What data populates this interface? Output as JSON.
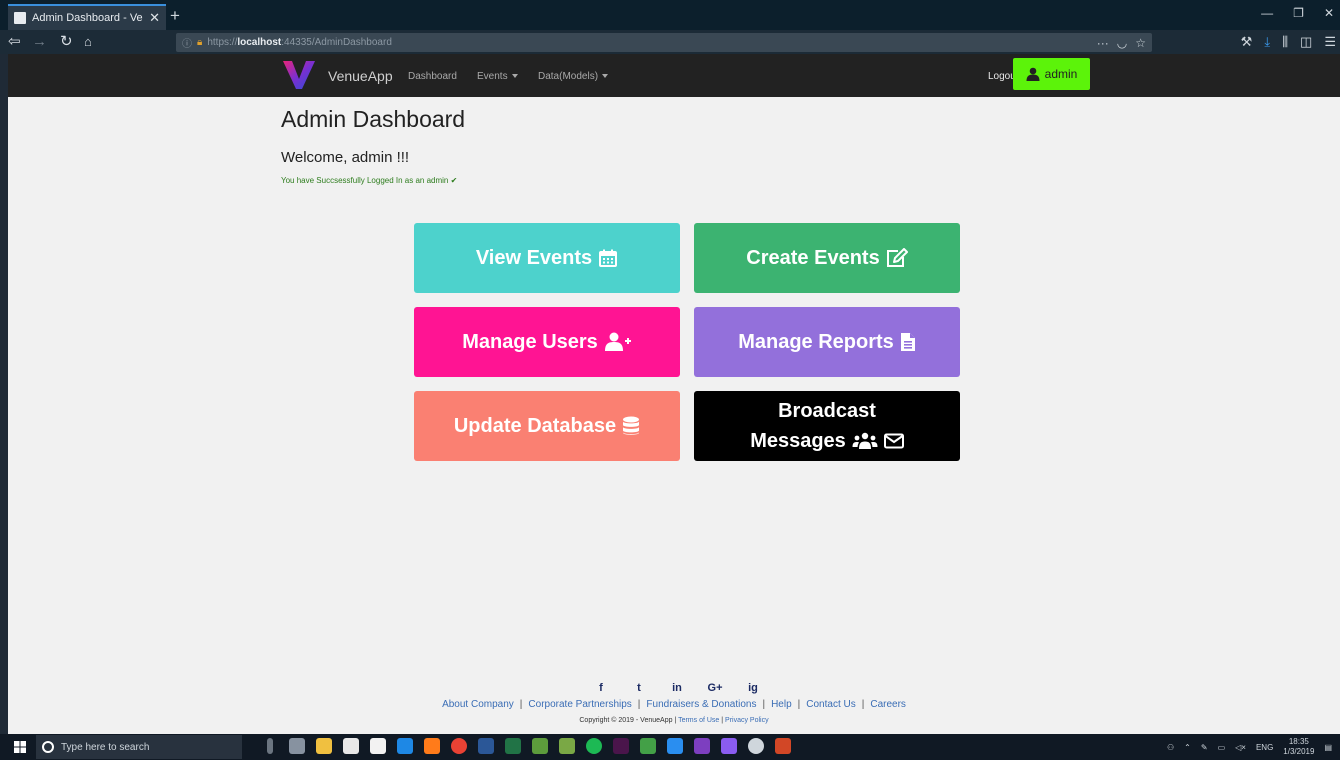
{
  "browser": {
    "tab_title": "Admin Dashboard - VenueApp",
    "tab_close": "✕",
    "new_tab": "+",
    "url_prefix": "https://",
    "url_host": "localhost",
    "url_rest": ":44335/AdminDashboard",
    "url_more": "···",
    "window_controls": [
      "—",
      "❐",
      "✕"
    ]
  },
  "app_nav": {
    "brand": "VenueApp",
    "links": [
      "Dashboard",
      "Events",
      "Data(Models)"
    ],
    "logout": "Logout",
    "user": "admin",
    "accent": "#5cf30a"
  },
  "main": {
    "title": "Admin Dashboard",
    "welcome": "Welcome, admin !!!",
    "success": "You have Succsessfully Logged In as an admin ✔"
  },
  "cards": [
    {
      "label": "View Events",
      "color": "#4dd2cc",
      "icon": "calendar-icon"
    },
    {
      "label": "Create Events",
      "color": "#3cb371",
      "icon": "edit-icon"
    },
    {
      "label": "Manage Users",
      "color": "#ff1493",
      "icon": "user-plus-icon"
    },
    {
      "label": "Manage Reports",
      "color": "#9370db",
      "icon": "file-icon"
    },
    {
      "label": "Update Database",
      "color": "#fa8072",
      "icon": "database-icon"
    },
    {
      "label_line1": "Broadcast",
      "label_line2": "Messages",
      "color": "#000000",
      "icon": "users-icon"
    }
  ],
  "footer": {
    "social": [
      "f",
      "t",
      "in",
      "G+",
      "ig"
    ],
    "links": [
      "About Company",
      "Corporate Partnerships",
      "Fundraisers & Donations",
      "Help",
      "Contact Us",
      "Careers"
    ],
    "copyright": "Copyright © 2019 - VenueApp |",
    "terms": "Terms of Use",
    "privacy": "Privacy Policy"
  },
  "taskbar": {
    "search_placeholder": "Type here to search",
    "lang": "ENG",
    "time": "18:35",
    "date": "1/3/2019"
  }
}
